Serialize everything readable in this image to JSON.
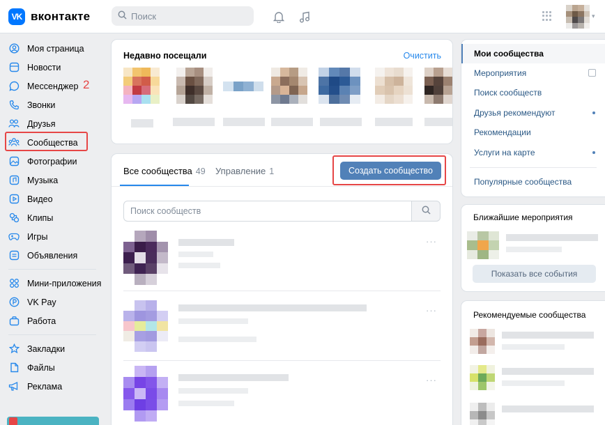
{
  "header": {
    "logo_mark": "VK",
    "logo_text": "вконтакте",
    "search_placeholder": "Поиск"
  },
  "sidebar": {
    "items": [
      {
        "label": "Моя страница",
        "icon": "user-circle-icon"
      },
      {
        "label": "Новости",
        "icon": "newsfeed-icon"
      },
      {
        "label": "Мессенджер",
        "icon": "chat-bubble-icon"
      },
      {
        "label": "Звонки",
        "icon": "phone-icon"
      },
      {
        "label": "Друзья",
        "icon": "friends-icon"
      },
      {
        "label": "Сообщества",
        "icon": "communities-icon"
      },
      {
        "label": "Фотографии",
        "icon": "photo-icon"
      },
      {
        "label": "Музыка",
        "icon": "music-icon"
      },
      {
        "label": "Видео",
        "icon": "video-icon"
      },
      {
        "label": "Клипы",
        "icon": "clips-icon"
      },
      {
        "label": "Игры",
        "icon": "gamepad-icon"
      },
      {
        "label": "Объявления",
        "icon": "classifieds-icon"
      }
    ],
    "items2": [
      {
        "label": "Мини-приложения",
        "icon": "mini-apps-icon"
      },
      {
        "label": "VK Pay",
        "icon": "vk-pay-icon"
      },
      {
        "label": "Работа",
        "icon": "briefcase-icon"
      }
    ],
    "items3": [
      {
        "label": "Закладки",
        "icon": "star-icon"
      },
      {
        "label": "Файлы",
        "icon": "file-icon"
      },
      {
        "label": "Реклама",
        "icon": "megaphone-icon"
      }
    ],
    "step_annotation": "2"
  },
  "recent": {
    "title": "Недавно посещали",
    "clear_label": "Очистить"
  },
  "communities": {
    "tab_all_label": "Все сообщества",
    "tab_all_count": "49",
    "tab_manage_label": "Управление",
    "tab_manage_count": "1",
    "create_label": "Создать сообщество",
    "search_placeholder": "Поиск сообществ",
    "more_label": "···"
  },
  "right_menu": {
    "items": [
      {
        "label": "Мои сообщества",
        "active": true
      },
      {
        "label": "Мероприятия"
      },
      {
        "label": "Поиск сообществ"
      },
      {
        "label": "Друзья рекомендуют"
      },
      {
        "label": "Рекомендации"
      },
      {
        "label": "Услуги на карте"
      },
      {
        "label": "Популярные сообщества"
      }
    ]
  },
  "events": {
    "title": "Ближайшие мероприятия",
    "show_all_label": "Показать все события"
  },
  "recommended": {
    "title": "Рекомендуемые сообщества"
  },
  "colors": {
    "accent": "#2688eb",
    "button": "#5181b8",
    "annotation": "#e64646"
  }
}
